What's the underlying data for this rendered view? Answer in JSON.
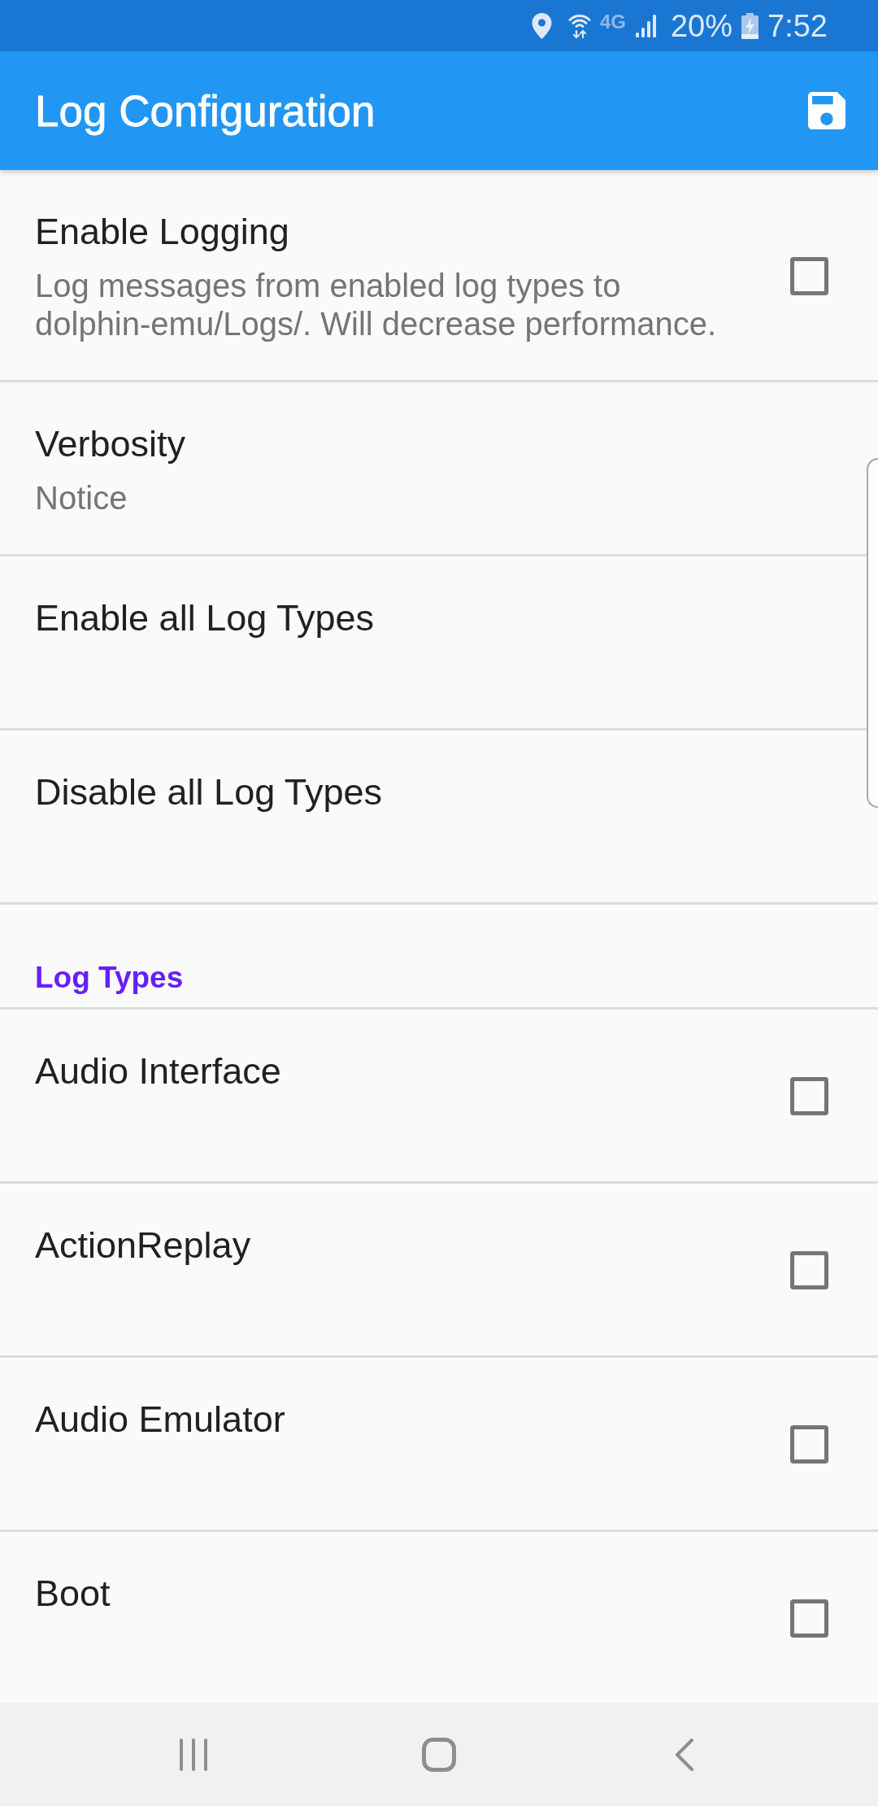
{
  "status_bar": {
    "network": "4G",
    "battery": "20%",
    "time": "7:52"
  },
  "app_bar": {
    "title": "Log Configuration"
  },
  "items": [
    {
      "kind": "checkbox",
      "title": "Enable Logging",
      "summary": "Log messages from enabled log types to dolphin-emu/Logs/. Will decrease performance.",
      "checked": false
    },
    {
      "kind": "choice",
      "title": "Verbosity",
      "summary": "Notice"
    },
    {
      "kind": "action",
      "title": "Enable all Log Types"
    },
    {
      "kind": "action",
      "title": "Disable all Log Types"
    },
    {
      "kind": "header",
      "title": "Log Types"
    },
    {
      "kind": "checkbox",
      "title": "Audio Interface",
      "checked": false
    },
    {
      "kind": "checkbox",
      "title": "ActionReplay",
      "checked": false
    },
    {
      "kind": "checkbox",
      "title": "Audio Emulator",
      "checked": false
    },
    {
      "kind": "checkbox",
      "title": "Boot",
      "checked": false
    }
  ]
}
